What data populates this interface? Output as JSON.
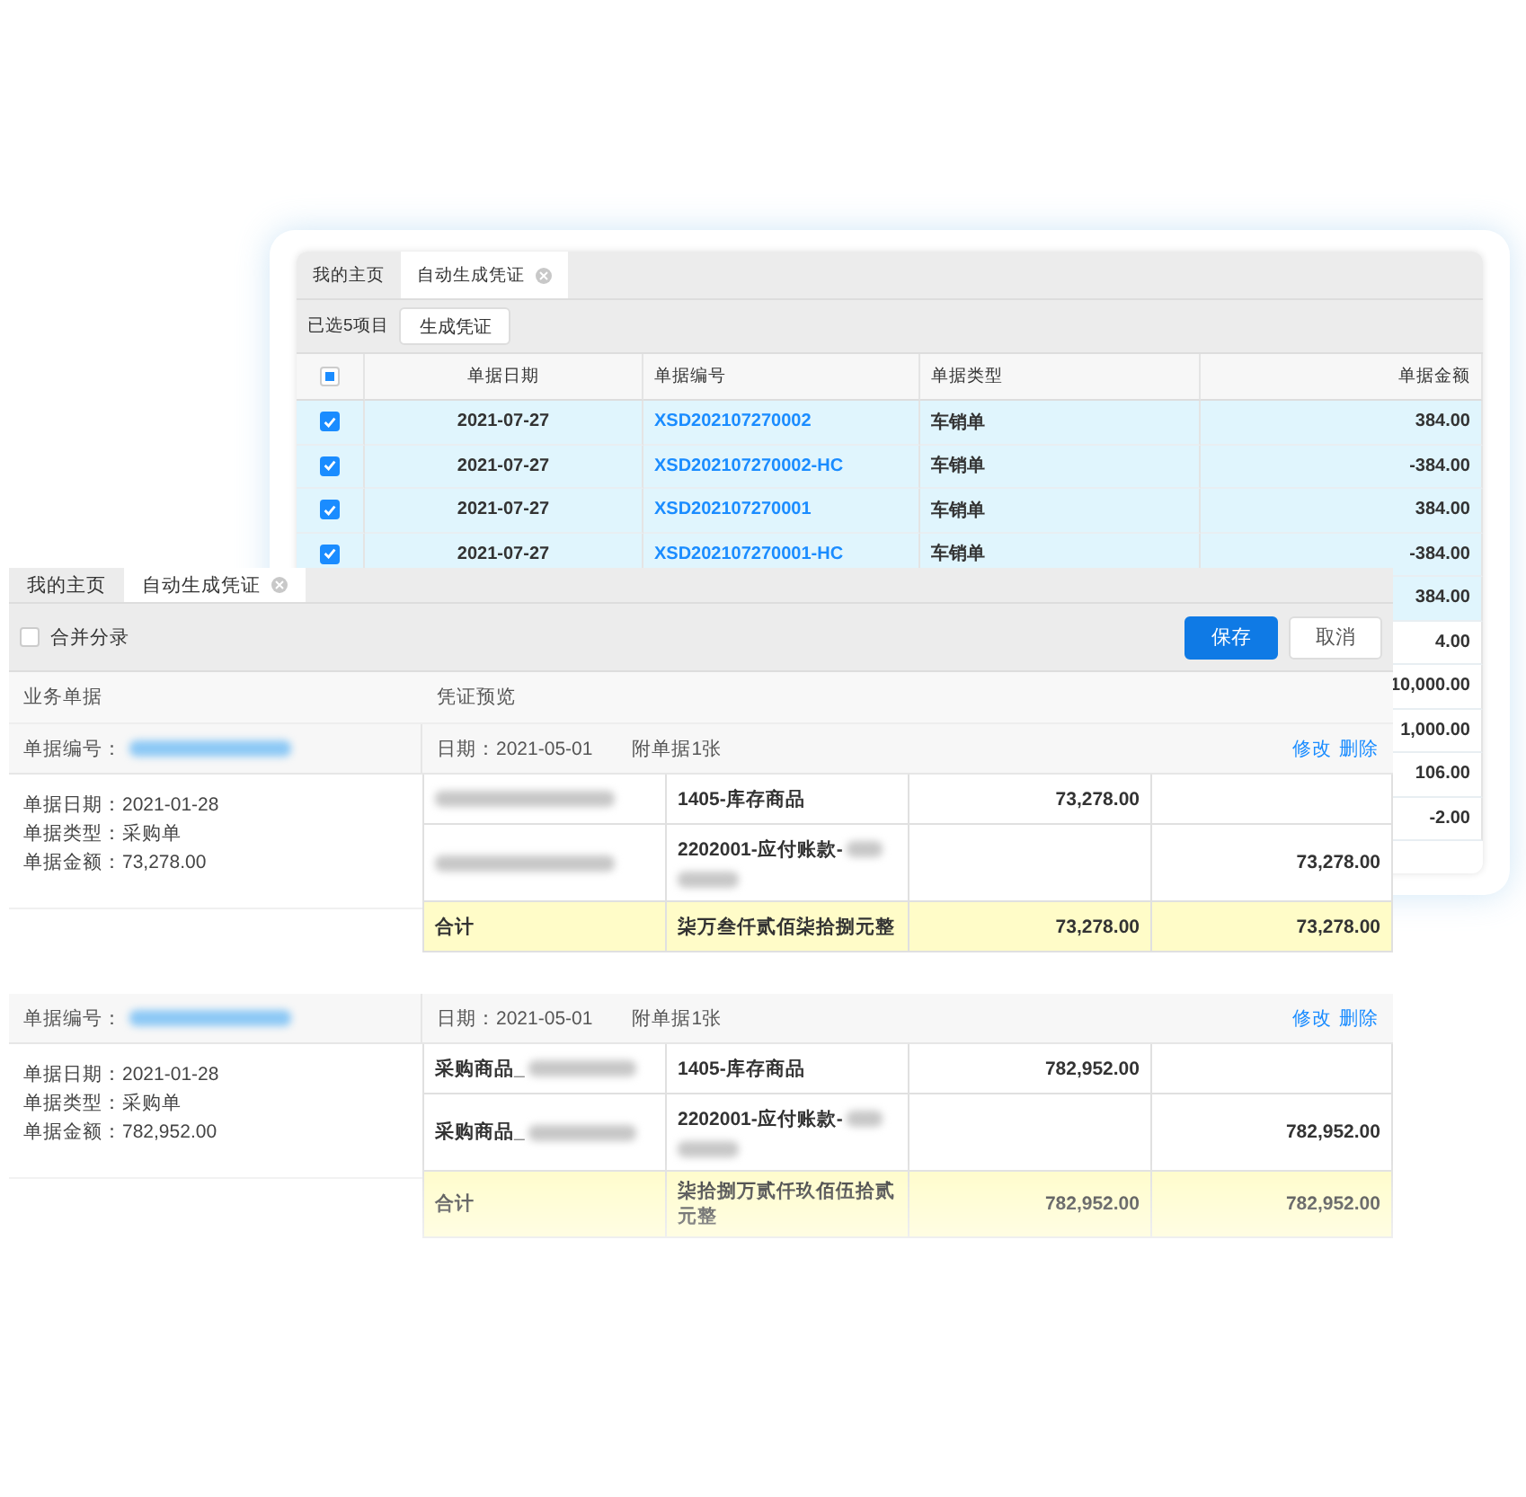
{
  "back_window": {
    "tabs": [
      {
        "label": "我的主页",
        "selected": false,
        "closable": false
      },
      {
        "label": "自动生成凭证",
        "selected": true,
        "closable": true
      }
    ],
    "selection_count": "已选5项目",
    "generate_button": "生成凭证",
    "table": {
      "header_checkbox": {
        "indeterminate": true
      },
      "columns": [
        "单据日期",
        "单据编号",
        "单据类型",
        "单据金额"
      ],
      "rows": [
        {
          "checked": true,
          "selected": true,
          "date": "2021-07-27",
          "number": "XSD202107270002",
          "type": "车销单",
          "amount": "384.00"
        },
        {
          "checked": true,
          "selected": true,
          "date": "2021-07-27",
          "number": "XSD202107270002-HC",
          "type": "车销单",
          "amount": "-384.00"
        },
        {
          "checked": true,
          "selected": true,
          "date": "2021-07-27",
          "number": "XSD202107270001",
          "type": "车销单",
          "amount": "384.00"
        },
        {
          "checked": true,
          "selected": true,
          "date": "2021-07-27",
          "number": "XSD202107270001-HC",
          "type": "车销单",
          "amount": "-384.00"
        },
        {
          "selected": true,
          "amount": "384.00"
        },
        {
          "selected": false,
          "amount": "4.00"
        },
        {
          "selected": false,
          "amount": "10,000.00"
        },
        {
          "selected": false,
          "amount": "1,000.00"
        },
        {
          "selected": false,
          "amount": "106.00"
        },
        {
          "selected": false,
          "amount": "-2.00"
        }
      ]
    }
  },
  "front_window": {
    "tabs": [
      {
        "label": "我的主页",
        "selected": false,
        "closable": false
      },
      {
        "label": "自动生成凭证",
        "selected": true,
        "closable": true
      }
    ],
    "merge_checkbox": {
      "label": "合并分录",
      "checked": false
    },
    "buttons": [
      {
        "label": "保存",
        "kind": "primary"
      },
      {
        "label": "取消",
        "kind": "default"
      }
    ],
    "headers": [
      "业务单据",
      "凭证预览"
    ],
    "documents": [
      {
        "number_label": "单据编号：",
        "number_redacted": true,
        "info": [
          "单据日期：2021-01-28",
          "单据类型：采购单",
          "单据金额：73,278.00"
        ],
        "voucher": {
          "date": "日期：2021-05-01",
          "attachments": "附单据1张",
          "actions": [
            "修改",
            "删除"
          ],
          "entries": [
            {
              "summary_redacted": true,
              "account": "1405-库存商品",
              "account_redacted": false,
              "debit": "73,278.00"
            },
            {
              "summary_redacted": true,
              "account": "2202001-应付账款-",
              "account_redacted": true,
              "credit": "73,278.00"
            }
          ],
          "total": {
            "label": "合计",
            "amount_words": "柒万叁仟贰佰柒拾捌元整",
            "debit": "73,278.00",
            "credit": "73,278.00"
          }
        }
      },
      {
        "number_label": "单据编号：",
        "number_redacted": true,
        "info": [
          "单据日期：2021-01-28",
          "单据类型：采购单",
          "单据金额：782,952.00"
        ],
        "voucher": {
          "date": "日期：2021-05-01",
          "attachments": "附单据1张",
          "actions": [
            "修改",
            "删除"
          ],
          "entries": [
            {
              "summary": "采购商品_",
              "summary_redacted": true,
              "account": "1405-库存商品",
              "account_redacted": false,
              "debit": "782,952.00"
            },
            {
              "summary": "采购商品_",
              "summary_redacted": true,
              "account": "2202001-应付账款-",
              "account_redacted": true,
              "credit": "782,952.00"
            }
          ],
          "total": {
            "label": "合计",
            "amount_words": "柒拾捌万贰仟玖佰伍拾贰元整",
            "debit": "782,952.00",
            "credit": "782,952.00"
          }
        }
      }
    ]
  }
}
